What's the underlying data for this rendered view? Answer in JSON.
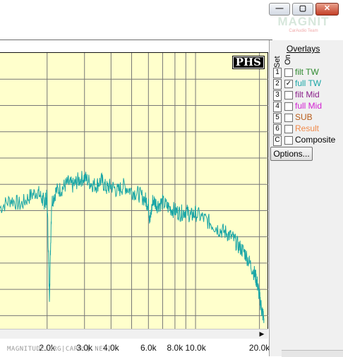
{
  "window": {
    "minimize_glyph": "—",
    "maximize_glyph": "▢",
    "close_glyph": "✕",
    "watermark_logo": "MAGNIT",
    "watermark_logo_sub": "CarAudio Team"
  },
  "plot": {
    "badge": "PHS",
    "scroll_arrow": "▶",
    "watermark_url": "MAGNITUDE.ORG|CARUS[.NET]"
  },
  "overlays": {
    "title": "Overlays",
    "set_label": "Set",
    "on_label": "On",
    "items": [
      {
        "set": "1",
        "label": "filt TW",
        "checked": false,
        "color": "#2f8a2f"
      },
      {
        "set": "2",
        "label": "full TW",
        "checked": true,
        "color": "#1aa6a6"
      },
      {
        "set": "3",
        "label": "filt Mid",
        "checked": false,
        "color": "#8a1f8a"
      },
      {
        "set": "4",
        "label": "full Mid",
        "checked": false,
        "color": "#d21fd2"
      },
      {
        "set": "5",
        "label": "SUB",
        "checked": false,
        "color": "#b85c1a"
      },
      {
        "set": "6",
        "label": "Result",
        "checked": false,
        "color": "#f08a4b"
      },
      {
        "set": "C",
        "label": "Composite",
        "checked": false,
        "color": "#000000"
      }
    ],
    "options_label": "Options..."
  },
  "chart_data": {
    "type": "line",
    "x_scale": "log",
    "xlim": [
      1200,
      21000
    ],
    "ylim": [
      0,
      1
    ],
    "grid": true,
    "x_ticks": [
      "2.0k",
      "3.0k",
      "4.0k",
      "6.0k",
      "8.0k",
      "10.0k",
      "20.0k"
    ],
    "series": [
      {
        "color": "#1aa6a6",
        "x": [
          1200,
          1350,
          1500,
          1650,
          1800,
          1900,
          1950,
          2000,
          2050,
          2100,
          2200,
          2350,
          2500,
          2650,
          2800,
          3000,
          3200,
          3400,
          3600,
          3800,
          4000,
          4300,
          4600,
          5000,
          5400,
          5800,
          6000,
          6100,
          6300,
          6600,
          7000,
          7500,
          8000,
          8500,
          9000,
          9500,
          10000,
          11000,
          12000,
          13000,
          14000,
          15000,
          16000,
          17000,
          18000,
          19000,
          19500,
          20000,
          20500,
          21000
        ],
        "y": [
          0.44,
          0.47,
          0.45,
          0.48,
          0.5,
          0.47,
          0.46,
          0.48,
          0.12,
          0.46,
          0.5,
          0.51,
          0.53,
          0.52,
          0.54,
          0.55,
          0.53,
          0.52,
          0.54,
          0.51,
          0.52,
          0.5,
          0.52,
          0.5,
          0.49,
          0.47,
          0.45,
          0.39,
          0.47,
          0.45,
          0.46,
          0.44,
          0.43,
          0.42,
          0.43,
          0.41,
          0.42,
          0.4,
          0.38,
          0.36,
          0.35,
          0.33,
          0.3,
          0.28,
          0.24,
          0.2,
          0.17,
          0.12,
          0.07,
          0.04
        ]
      }
    ]
  }
}
